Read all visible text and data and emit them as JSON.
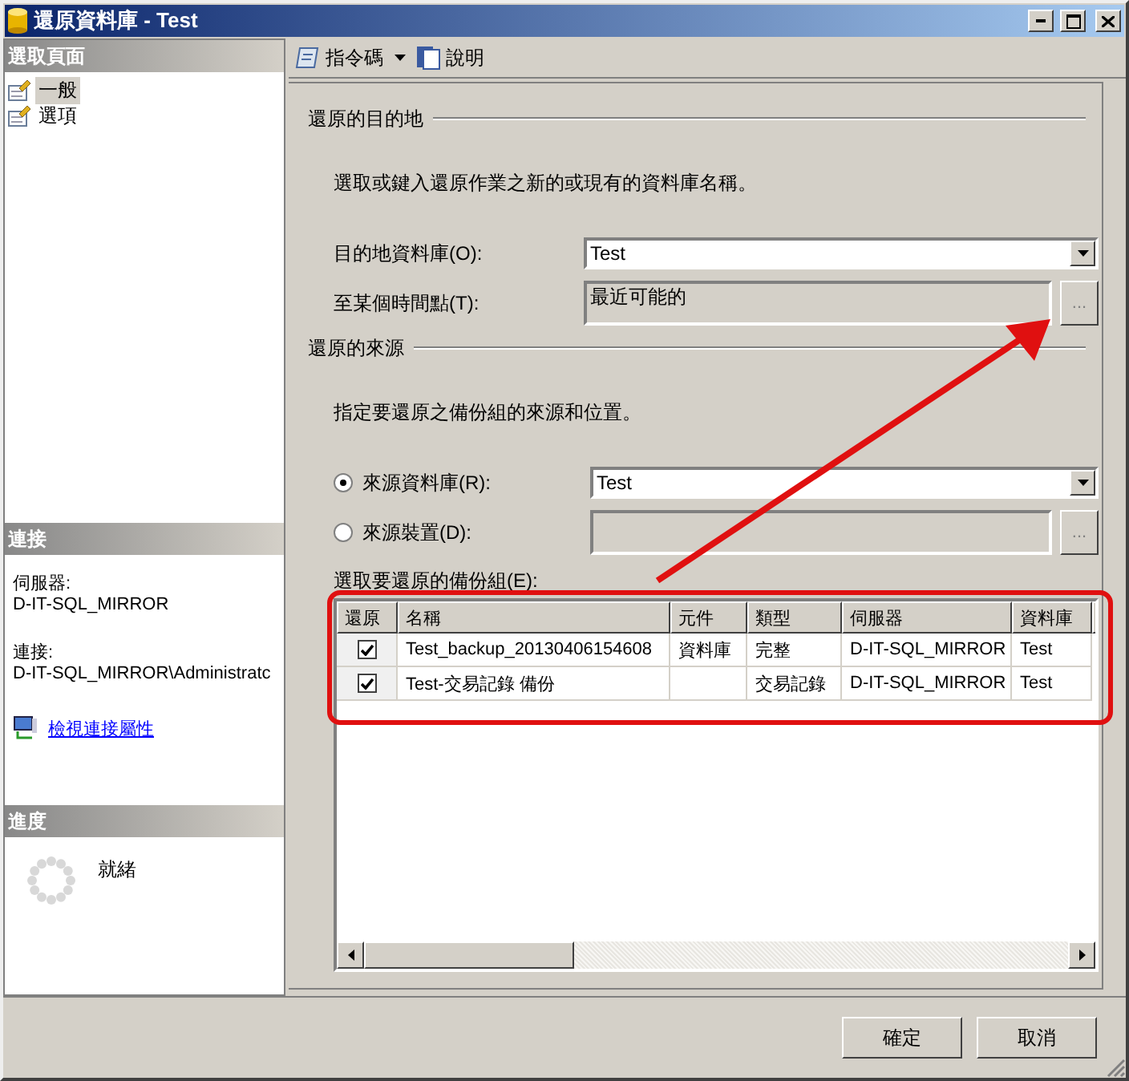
{
  "window": {
    "title": "還原資料庫 - Test"
  },
  "sidebar": {
    "header": "選取頁面",
    "pages": [
      {
        "label": "一般",
        "selected": true
      },
      {
        "label": "選項",
        "selected": false
      }
    ],
    "connection": {
      "header": "連接",
      "server_label": "伺服器:",
      "server": "D-IT-SQL_MIRROR",
      "connection_label": "連接:",
      "connection": "D-IT-SQL_MIRROR\\Administratc",
      "link": "檢視連接屬性"
    },
    "progress": {
      "header": "進度",
      "status": "就緒"
    }
  },
  "toolbar": [
    {
      "kind": "dropdown",
      "label": "指令碼"
    },
    {
      "kind": "plain",
      "label": "說明"
    }
  ],
  "destination": {
    "title": "還原的目的地",
    "description": "選取或鍵入還原作業之新的或現有的資料庫名稱。",
    "fields": [
      {
        "kind": "dropdown",
        "label": "目的地資料庫(O):",
        "value": "Test",
        "disabled": false
      },
      {
        "kind": "browse",
        "label": "至某個時間點(T):",
        "value": "最近可能的",
        "disabled": true,
        "button": "..."
      }
    ]
  },
  "source": {
    "title": "還原的來源",
    "description": "指定要還原之備份組的來源和位置。",
    "options": [
      {
        "kind": "dropdown",
        "label": "來源資料庫(R):",
        "value": "Test",
        "selected": true,
        "disabled": false
      },
      {
        "kind": "browse",
        "label": "來源裝置(D):",
        "selected": false,
        "disabled": true,
        "button": "..."
      }
    ]
  },
  "backup_sets": {
    "label": "選取要還原的備份組(E):",
    "columns": [
      "還原",
      "名稱",
      "元件",
      "類型",
      "伺服器",
      "資料庫"
    ],
    "rows": [
      {
        "checked": true,
        "cells": [
          "",
          "Test_backup_20130406154608",
          "資料庫",
          "完整",
          "D-IT-SQL_MIRROR",
          "Test"
        ]
      },
      {
        "checked": true,
        "cells": [
          "",
          "Test-交易記錄  備份",
          "",
          "交易記錄",
          "D-IT-SQL_MIRROR",
          "Test"
        ]
      }
    ]
  },
  "buttons": [
    "確定",
    "取消"
  ]
}
